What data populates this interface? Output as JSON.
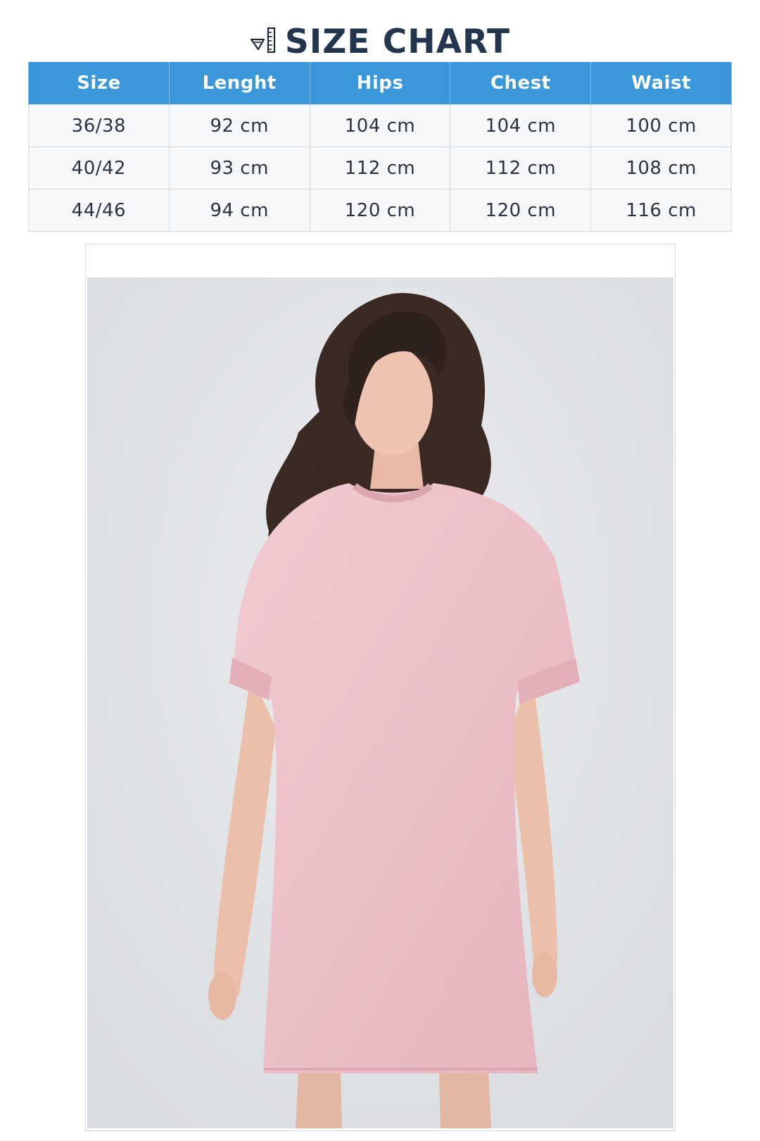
{
  "title": "SIZE CHART",
  "title_icon": "ruler-icon",
  "table": {
    "headers": [
      "Size",
      "Lenght",
      "Hips",
      "Chest",
      "Waist"
    ],
    "rows": [
      [
        "36/38",
        "92 cm",
        "104 cm",
        "104 cm",
        "100 cm"
      ],
      [
        "40/42",
        "93 cm",
        "112 cm",
        "112 cm",
        "108 cm"
      ],
      [
        "44/46",
        "94 cm",
        "120 cm",
        "120 cm",
        "116 cm"
      ]
    ]
  },
  "colors": {
    "title": "#22364f",
    "header_bg": "#3a97da",
    "header_text": "#ffffff",
    "cell_bg": "#f5f7f9",
    "cell_text": "#2b3440",
    "dress": "#eec4cb",
    "backdrop": "#e2e4e7"
  }
}
